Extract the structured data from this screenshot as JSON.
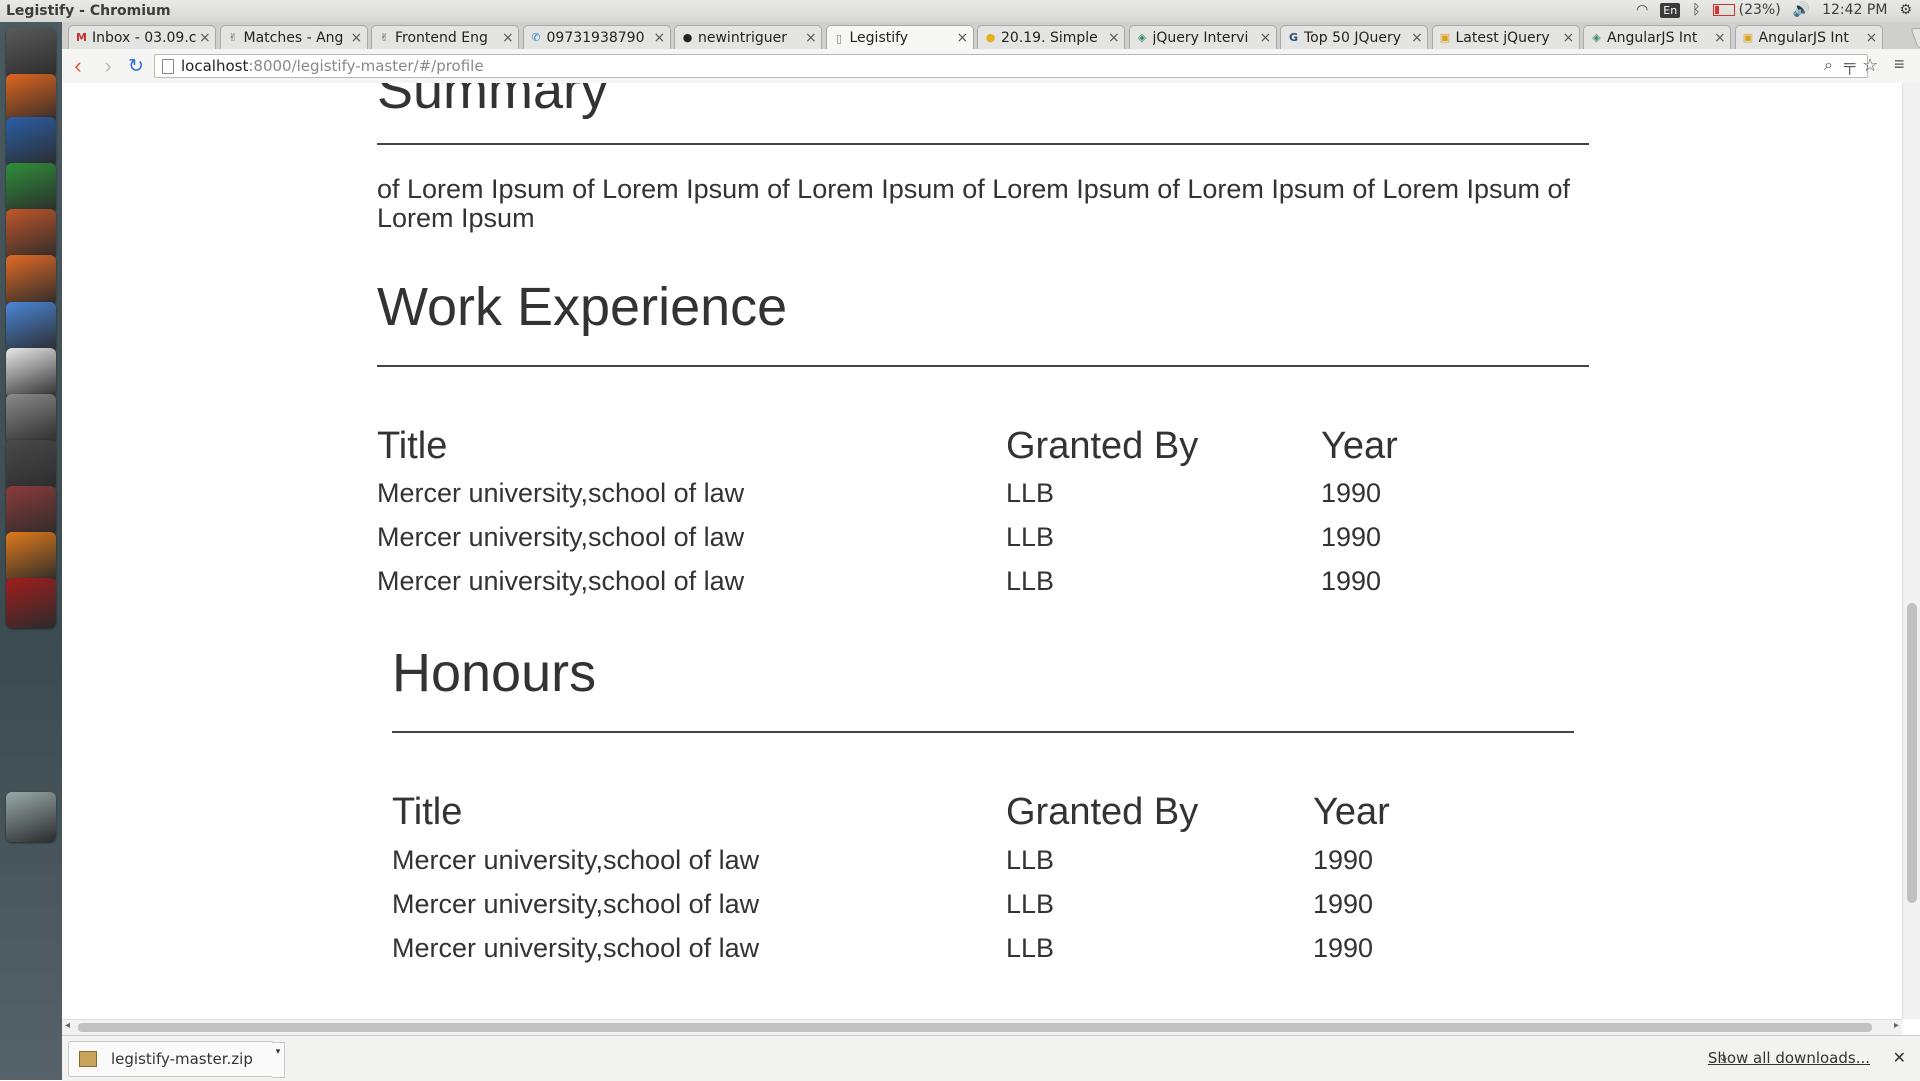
{
  "window": {
    "title": "Legistify - Chromium"
  },
  "tray": {
    "kbd": "En",
    "battery": "(23%)",
    "time": "12:42 PM"
  },
  "tabs": [
    {
      "label": "Inbox - 03.09.c",
      "fav": "M",
      "favcolor": "#c4302b"
    },
    {
      "label": "Matches - Ang",
      "fav": "✌",
      "favcolor": "#666"
    },
    {
      "label": "Frontend Eng",
      "fav": "✌",
      "favcolor": "#666"
    },
    {
      "label": "09731938790",
      "fav": "✆",
      "favcolor": "#2a7fd4"
    },
    {
      "label": "newintriguer",
      "fav": "●",
      "favcolor": "#222"
    },
    {
      "label": "Legistify",
      "fav": "▯",
      "favcolor": "#777",
      "active": true
    },
    {
      "label": "20.19. Simple",
      "fav": "●",
      "favcolor": "#e0b21c"
    },
    {
      "label": "jQuery Intervi",
      "fav": "◈",
      "favcolor": "#3d8b6d"
    },
    {
      "label": "Top 50 JQuery",
      "fav": "G",
      "favcolor": "#2a4d7a"
    },
    {
      "label": "Latest jQuery",
      "fav": "▣",
      "favcolor": "#d9a41d"
    },
    {
      "label": "AngularJS Int",
      "fav": "◈",
      "favcolor": "#3d8b6d"
    },
    {
      "label": "AngularJS Int",
      "fav": "▣",
      "favcolor": "#d9a41d"
    }
  ],
  "address": {
    "host": "localhost",
    "rest": ":8000/legistify-master/#/profile"
  },
  "summary": {
    "heading": "Summary",
    "text": "of Lorem Ipsum of Lorem Ipsum of Lorem Ipsum of Lorem Ipsum of Lorem Ipsum of Lorem Ipsum of Lorem Ipsum"
  },
  "work_experience": {
    "heading": "Work Experience",
    "columns": [
      "Title",
      "Granted By",
      "Year"
    ],
    "rows": [
      [
        "Mercer university,school of law",
        "LLB",
        "1990"
      ],
      [
        "Mercer university,school of law",
        "LLB",
        "1990"
      ],
      [
        "Mercer university,school of law",
        "LLB",
        "1990"
      ]
    ]
  },
  "honours": {
    "heading": "Honours",
    "columns": [
      "Title",
      "Granted By",
      "Year"
    ],
    "rows": [
      [
        "Mercer university,school of law",
        "LLB",
        "1990"
      ],
      [
        "Mercer university,school of law",
        "LLB",
        "1990"
      ],
      [
        "Mercer university,school of law",
        "LLB",
        "1990"
      ]
    ]
  },
  "downloads": {
    "file": "legistify-master.zip",
    "show_all": "Show all downloads..."
  },
  "launcher": [
    {
      "name": "dash-home-icon",
      "color": "#5a5a5a"
    },
    {
      "name": "firefox-icon",
      "color": "#e0651f"
    },
    {
      "name": "libreoffice-writer-icon",
      "color": "#2b5fa6"
    },
    {
      "name": "libreoffice-calc-icon",
      "color": "#2f8f3a"
    },
    {
      "name": "libreoffice-impress-icon",
      "color": "#c1562a"
    },
    {
      "name": "software-center-icon",
      "color": "#e26a25"
    },
    {
      "name": "chromium-icon",
      "color": "#4a86d8"
    },
    {
      "name": "amazon-icon",
      "color": "#e9e9e9"
    },
    {
      "name": "system-settings-icon",
      "color": "#8a8a8a"
    },
    {
      "name": "sublime-text-icon",
      "color": "#4a4a4a"
    },
    {
      "name": "file-manager-icon",
      "color": "#8c3b3b"
    },
    {
      "name": "vlc-icon",
      "color": "#e07a1a"
    },
    {
      "name": "workspace-switcher-icon",
      "color": "#a11d1d"
    },
    {
      "name": "trash-icon",
      "color": "#9aa"
    }
  ]
}
